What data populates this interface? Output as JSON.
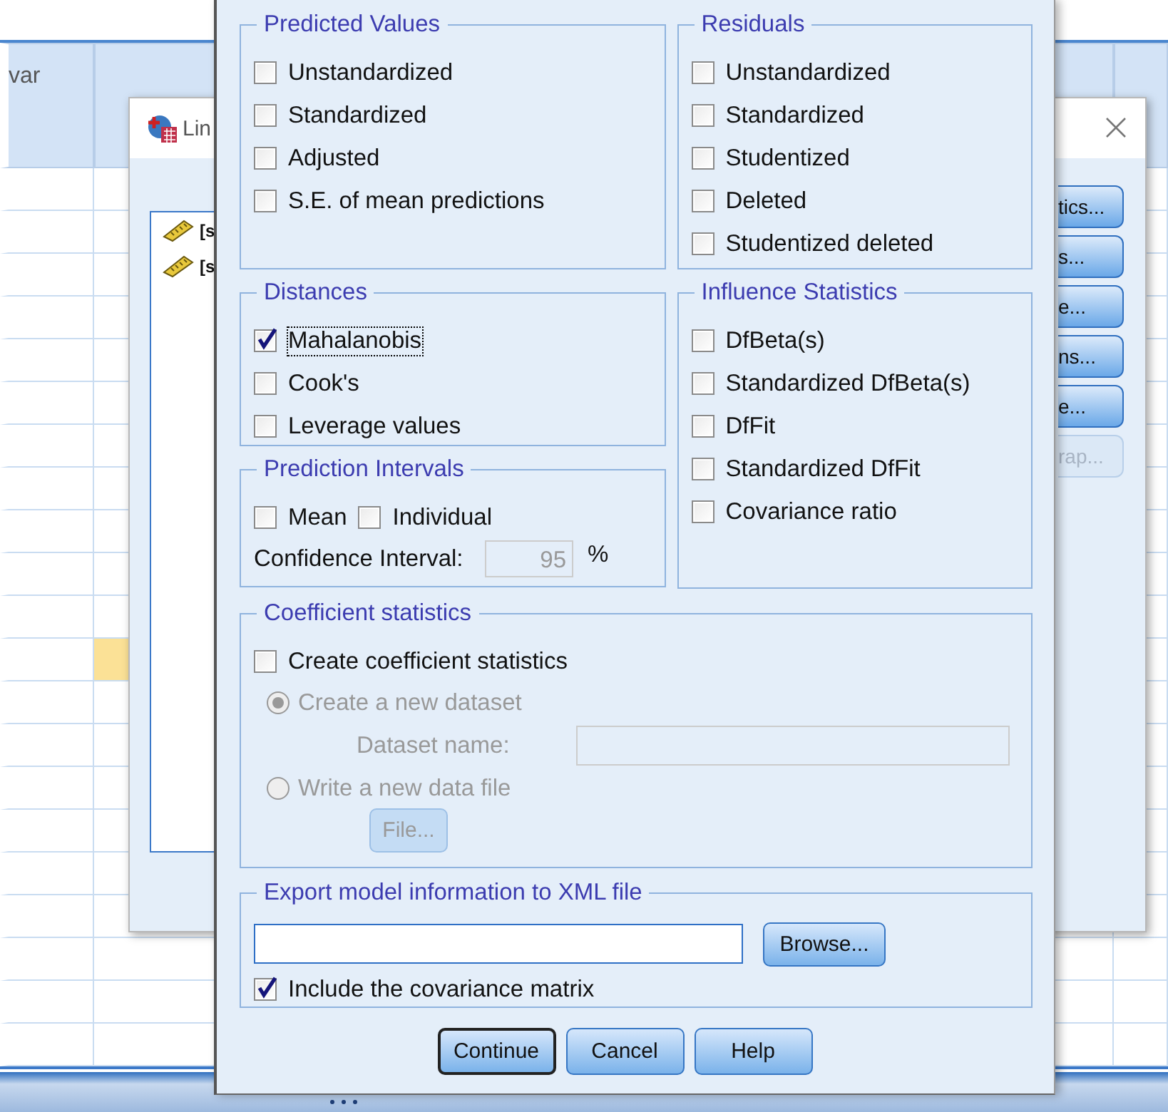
{
  "grid": {
    "column_header": "var",
    "rows": [
      {
        "selected": false
      },
      {
        "selected": false
      },
      {
        "selected": false
      },
      {
        "selected": false
      },
      {
        "selected": false
      },
      {
        "selected": false
      },
      {
        "selected": false
      },
      {
        "selected": false
      },
      {
        "selected": false
      },
      {
        "selected": false
      },
      {
        "selected": false
      },
      {
        "selected": true
      },
      {
        "selected": false
      },
      {
        "selected": false
      },
      {
        "selected": false
      },
      {
        "selected": false
      },
      {
        "selected": false
      },
      {
        "selected": false
      },
      {
        "selected": false
      },
      {
        "selected": false
      },
      {
        "selected": false
      }
    ]
  },
  "regression_dialog": {
    "title": "Lin",
    "variables": [
      {
        "text": "[s"
      },
      {
        "text": "[s"
      }
    ],
    "buttons": [
      {
        "label": "tics...",
        "disabled": false
      },
      {
        "label": "s...",
        "disabled": false
      },
      {
        "label": "e...",
        "disabled": false
      },
      {
        "label": "ns...",
        "disabled": false
      },
      {
        "label": "e...",
        "disabled": false
      },
      {
        "label": "rap...",
        "disabled": true
      }
    ]
  },
  "save_dialog": {
    "predicted_values": {
      "title": "Predicted Values",
      "options": [
        {
          "label": "Unstandardized",
          "checked": false
        },
        {
          "label": "Standardized",
          "checked": false
        },
        {
          "label": "Adjusted",
          "checked": false
        },
        {
          "label": "S.E. of mean predictions",
          "checked": false
        }
      ]
    },
    "residuals": {
      "title": "Residuals",
      "options": [
        {
          "label": "Unstandardized",
          "checked": false
        },
        {
          "label": "Standardized",
          "checked": false
        },
        {
          "label": "Studentized",
          "checked": false
        },
        {
          "label": "Deleted",
          "checked": false
        },
        {
          "label": "Studentized deleted",
          "checked": false
        }
      ]
    },
    "distances": {
      "title": "Distances",
      "options": [
        {
          "label": "Mahalanobis",
          "checked": true,
          "focused": true
        },
        {
          "label": "Cook's",
          "checked": false,
          "focused": false
        },
        {
          "label": "Leverage values",
          "checked": false,
          "focused": false
        }
      ]
    },
    "prediction_intervals": {
      "title": "Prediction Intervals",
      "options": [
        {
          "label": "Mean",
          "checked": false
        },
        {
          "label": "Individual",
          "checked": false
        }
      ],
      "ci_label": "Confidence Interval:",
      "ci_value": "95",
      "ci_unit": "%",
      "ci_disabled": true
    },
    "influence_statistics": {
      "title": "Influence Statistics",
      "options": [
        {
          "label": "DfBeta(s)",
          "checked": false
        },
        {
          "label": "Standardized DfBeta(s)",
          "checked": false
        },
        {
          "label": "DfFit",
          "checked": false
        },
        {
          "label": "Standardized DfFit",
          "checked": false
        },
        {
          "label": "Covariance ratio",
          "checked": false
        }
      ]
    },
    "coefficient_statistics": {
      "title": "Coefficient statistics",
      "create": {
        "label": "Create coefficient statistics",
        "checked": false
      },
      "disabled": true,
      "radios": [
        {
          "label": "Create a new dataset",
          "selected": true
        },
        {
          "label": "Write a new data file",
          "selected": false
        }
      ],
      "dataset_label": "Dataset name:",
      "file_button": "File..."
    },
    "export_xml": {
      "title": "Export model information to XML file",
      "browse_button": "Browse...",
      "include": {
        "label": "Include the covariance matrix",
        "checked": true
      }
    },
    "buttons": [
      {
        "label": "Continue",
        "default": true
      },
      {
        "label": "Cancel",
        "default": false
      },
      {
        "label": "Help",
        "default": false
      }
    ]
  }
}
